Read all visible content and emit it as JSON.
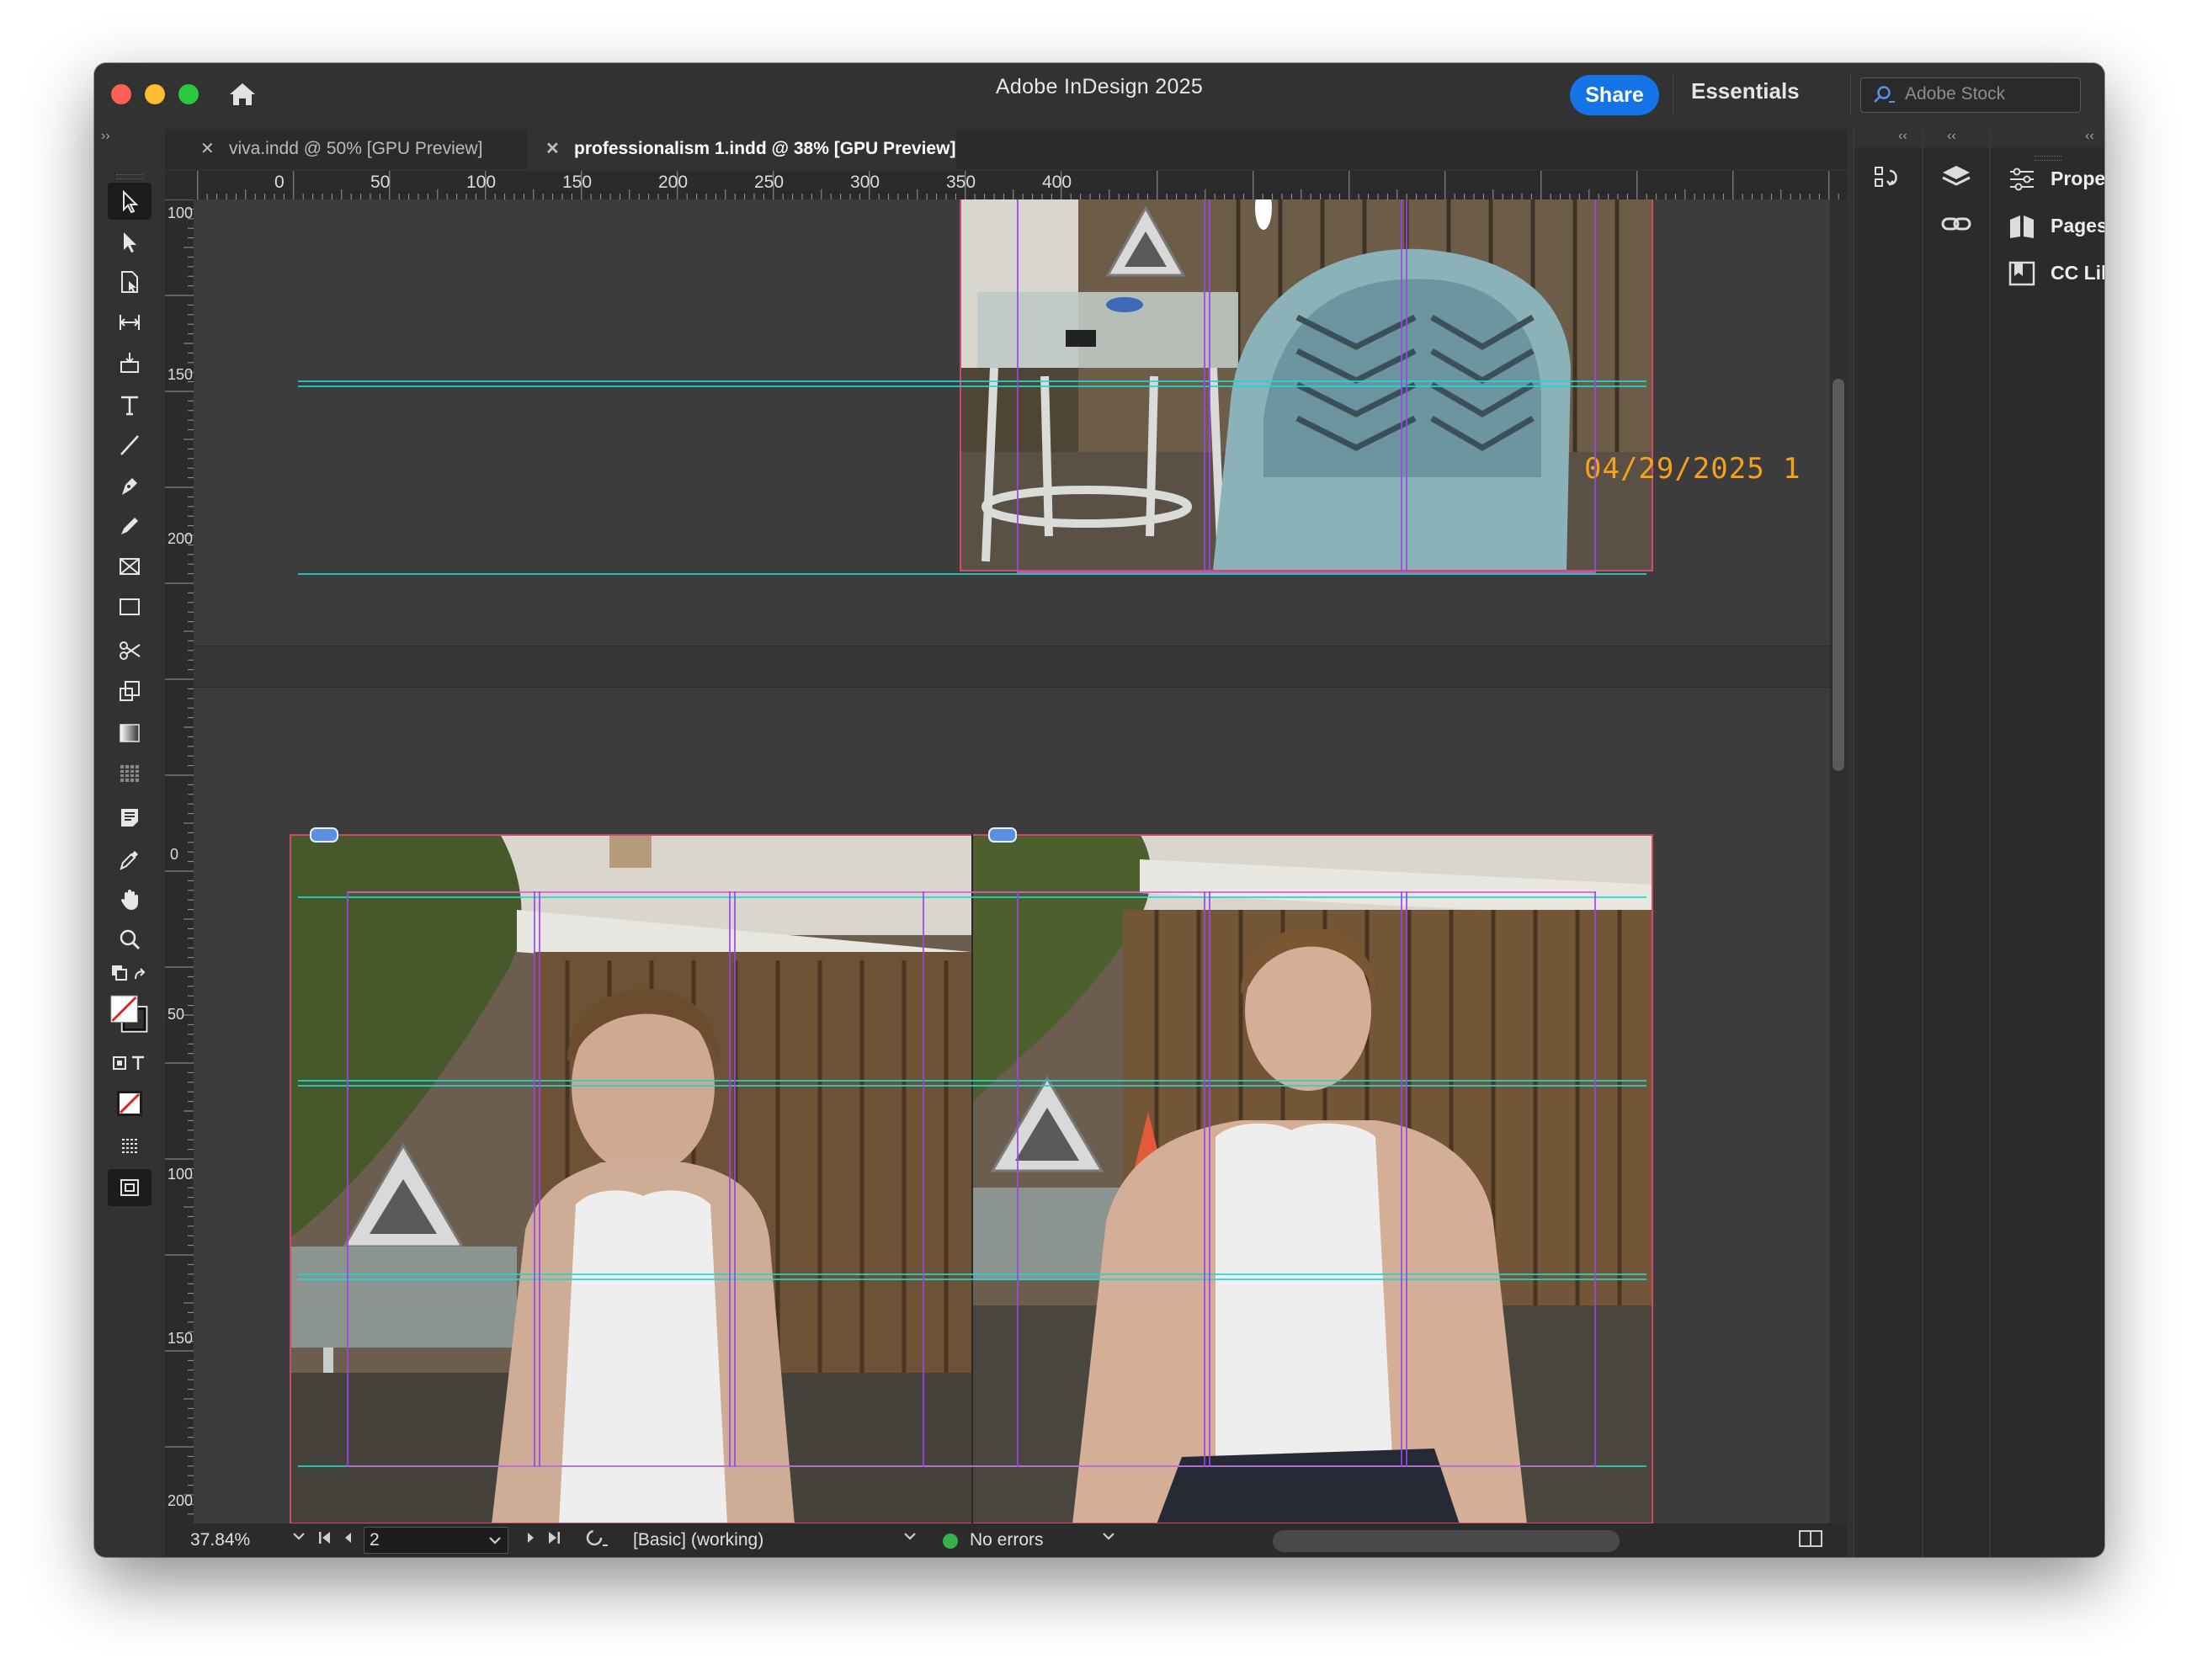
{
  "app": {
    "title": "Adobe InDesign 2025",
    "share_label": "Share",
    "workspace_label": "Essentials",
    "stock_placeholder": "Adobe Stock"
  },
  "tabs": [
    {
      "label": "viva.indd @ 50% [GPU Preview]",
      "active": false
    },
    {
      "label": "professionalism 1.indd @ 38% [GPU Preview]",
      "active": true
    }
  ],
  "ruler": {
    "h_ticks": [
      "0",
      "50",
      "100",
      "150",
      "200",
      "250",
      "300",
      "350",
      "400"
    ],
    "v_ticks_top": [
      "100",
      "150",
      "200"
    ],
    "v_ticks_bottom": [
      "0",
      "50",
      "100",
      "150",
      "200"
    ]
  },
  "canvas": {
    "date_stamp": "04/29/2025  1"
  },
  "statusbar": {
    "zoom": "37.84%",
    "page": "2",
    "style": "[Basic] (working)",
    "preflight": "No errors"
  },
  "panels": {
    "items": [
      {
        "label": "Properties",
        "icon": "properties-icon"
      },
      {
        "label": "Pages",
        "icon": "pages-icon"
      },
      {
        "label": "CC Libraries",
        "icon": "cc-libraries-icon"
      }
    ]
  },
  "colors": {
    "accent": "#1473e6",
    "guide_cyan": "#1fd6d6",
    "guide_purple": "#9a46e6",
    "guide_magenta": "#d25ed8",
    "frame_red": "#d14a6a",
    "status_ok": "#36b24a"
  }
}
